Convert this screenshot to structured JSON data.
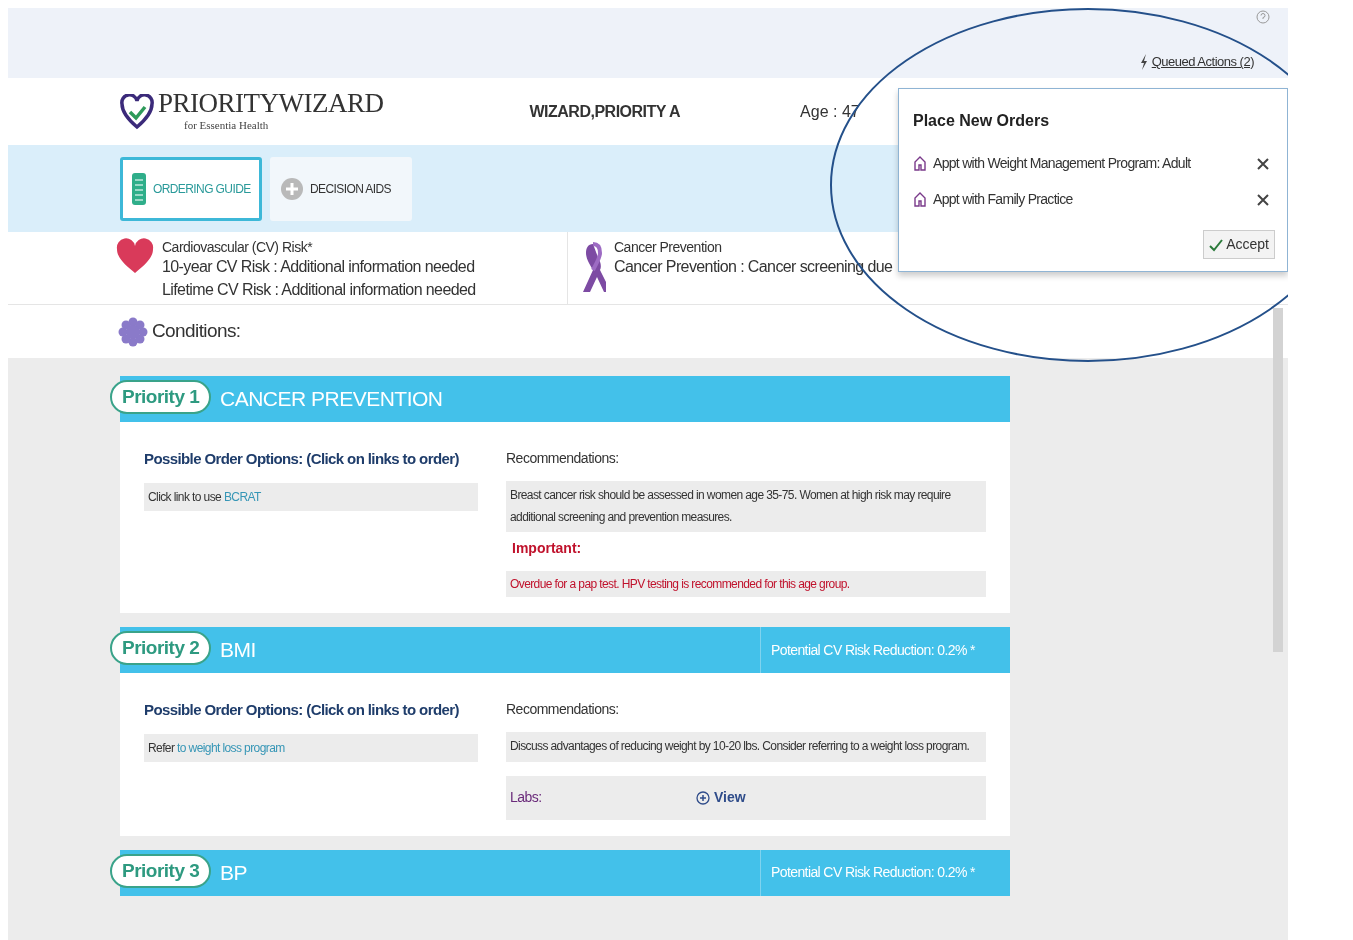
{
  "top_bar": {
    "queued_actions": "Queued Actions (2)"
  },
  "header": {
    "logo_title": "PRIORITYWIZARD",
    "logo_subtitle": "for Essentia Health",
    "patient_name": "WIZARD,PRIORITY A",
    "age": "Age : 47"
  },
  "tabs": [
    {
      "label": "ORDERING GUIDE",
      "selected": true,
      "kind": "clipboard"
    },
    {
      "label": "DECISION AIDS",
      "selected": false,
      "kind": "plus"
    }
  ],
  "risk_panels": [
    {
      "kind": "heart",
      "title": "Cardiovascular (CV) Risk*",
      "lines": [
        "10-year CV Risk : Additional information needed",
        "Lifetime CV Risk : Additional information needed"
      ]
    },
    {
      "kind": "ribbon",
      "title": "Cancer Prevention",
      "lines": [
        "Cancer Prevention : Cancer screening due"
      ]
    }
  ],
  "conditions_label": "Conditions:",
  "priorities": [
    {
      "badge": "Priority 1",
      "title": "CANCER PREVENTION",
      "options_heading": "Possible Order Options: (Click on links to order)",
      "option_prefix": "Click link to use",
      "option_link": "BCRAT",
      "recommendations_heading": "Recommendations:",
      "recommendation": "Breast cancer risk should be assessed in women age 35-75. Women at high risk may require additional screening and prevention measures.",
      "important_heading": "Important:",
      "important_text": "Overdue for a pap test. HPV testing is recommended for this age group."
    },
    {
      "badge": "Priority 2",
      "title": "BMI",
      "risk_reduction": "Potential CV Risk Reduction: 0.2% *",
      "options_heading": "Possible Order Options: (Click on links to order)",
      "option_prefix": "Refer",
      "option_link": "to weight loss program",
      "recommendations_heading": "Recommendations:",
      "recommendation": "Discuss advantages of reducing weight by 10-20 lbs. Consider referring to a weight loss program.",
      "labs_label": "Labs:",
      "labs_link": "View"
    },
    {
      "badge": "Priority 3",
      "title": "BP",
      "risk_reduction": "Potential CV Risk Reduction: 0.2% *"
    }
  ],
  "popover": {
    "title": "Place New Orders",
    "orders": [
      {
        "label": "Appt with Weight Management Program: Adult"
      },
      {
        "label": "Appt with Family Practice"
      }
    ],
    "accept": "Accept"
  }
}
